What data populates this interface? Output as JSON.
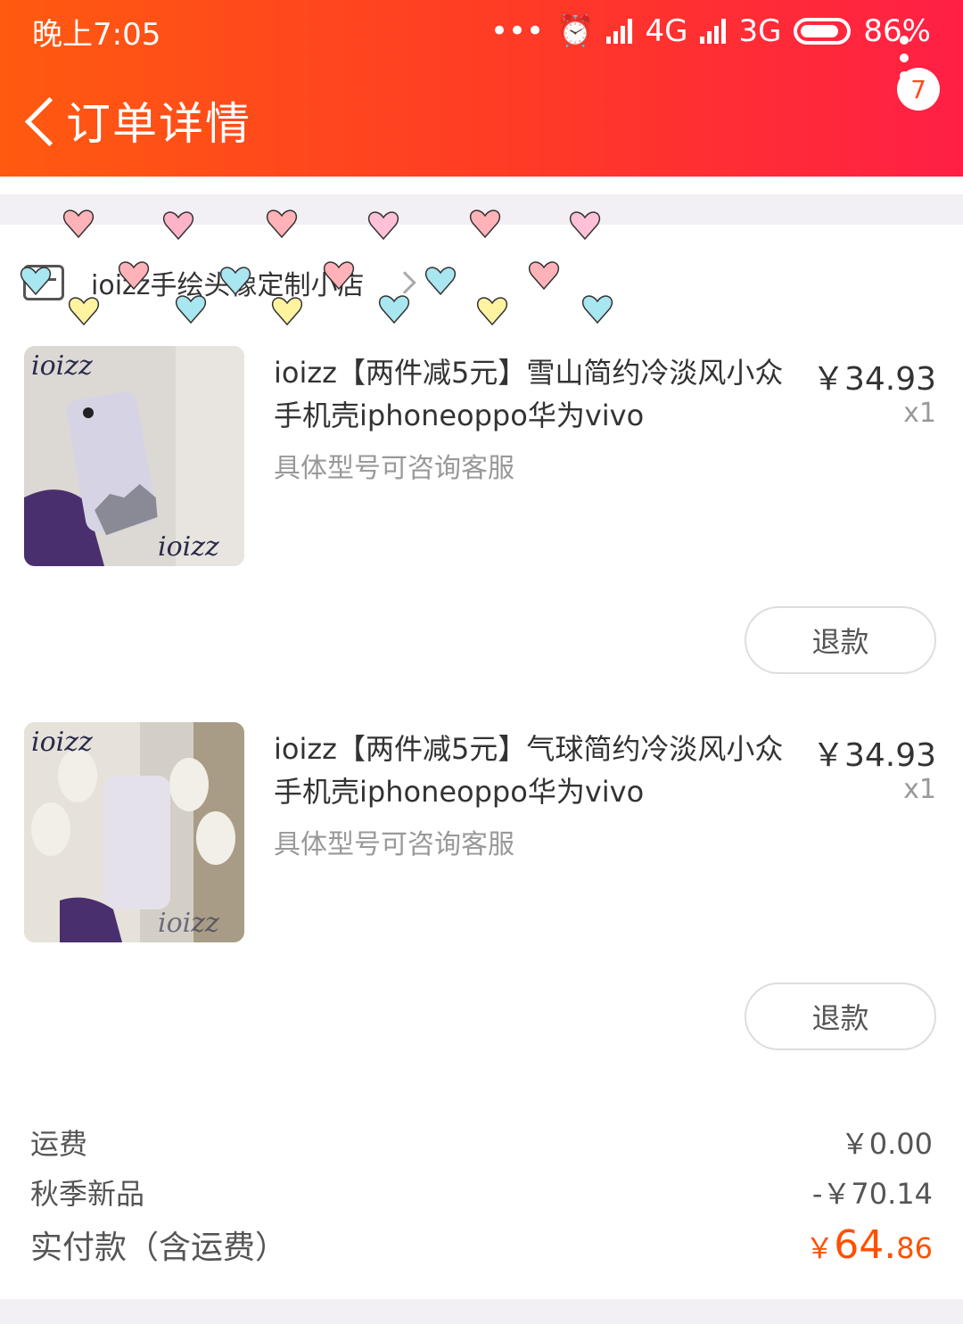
{
  "status_bar": {
    "time": "晚上7:05",
    "dots": "•••",
    "net1": "4G",
    "net2": "3G",
    "battery": "86%"
  },
  "header": {
    "title": "订单详情",
    "badge_count": "7"
  },
  "shop": {
    "name": "ioizz手绘头像定制小店"
  },
  "items": [
    {
      "title": "ioizz【两件减5元】雪山简约冷淡风小众手机壳iphoneoppo华为vivo",
      "spec": "具体型号可咨询客服",
      "price": "￥34.93",
      "qty": "x1",
      "refund_label": "退款"
    },
    {
      "title": "ioizz【两件减5元】气球简约冷淡风小众手机壳iphoneoppo华为vivo",
      "spec": "具体型号可咨询客服",
      "price": "￥34.93",
      "qty": "x1",
      "refund_label": "退款"
    }
  ],
  "summary": {
    "shipping_label": "运费",
    "shipping_value": "￥0.00",
    "promo_label": "秋季新品",
    "promo_value": "-￥70.14",
    "total_label": "实付款（含运费）",
    "total_currency": "￥",
    "total_int": "64.",
    "total_dec": "86"
  },
  "colors": {
    "header_start": "#ff5a10",
    "header_end": "#ff1f45",
    "total_price": "#ff5000"
  }
}
